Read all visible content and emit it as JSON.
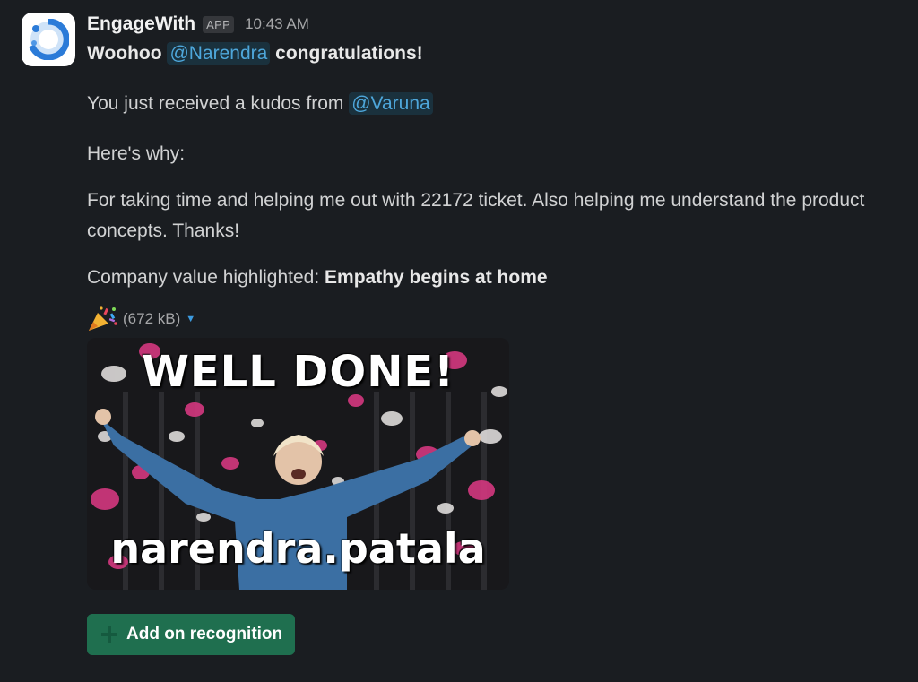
{
  "message": {
    "sender": "EngageWith",
    "badge": "APP",
    "timestamp": "10:43 AM",
    "line1": {
      "lead": "Woohoo",
      "mention": "@Narendra",
      "trail": "congratulations!"
    },
    "line2": {
      "text": "You just received a kudos from",
      "mention": "@Varuna"
    },
    "why_label": "Here's why:",
    "reason": "For taking time and helping me out with 22172 ticket. Also helping me understand the product concepts. Thanks!",
    "value": {
      "label": "Company value highlighted:",
      "name": "Empathy begins at home"
    },
    "attachment": {
      "icon": "party-popper-icon",
      "size": "(672 kB)",
      "gif_top_caption": "WELL DONE!",
      "gif_bottom_caption": "narendra.patala"
    },
    "action": {
      "label": "Add on recognition",
      "icon": "plus-icon"
    }
  },
  "colors": {
    "background": "#1a1d21",
    "mention": "#4ea7db",
    "button": "#1f6f4f",
    "avatar_ring": "#2b7bd8"
  }
}
